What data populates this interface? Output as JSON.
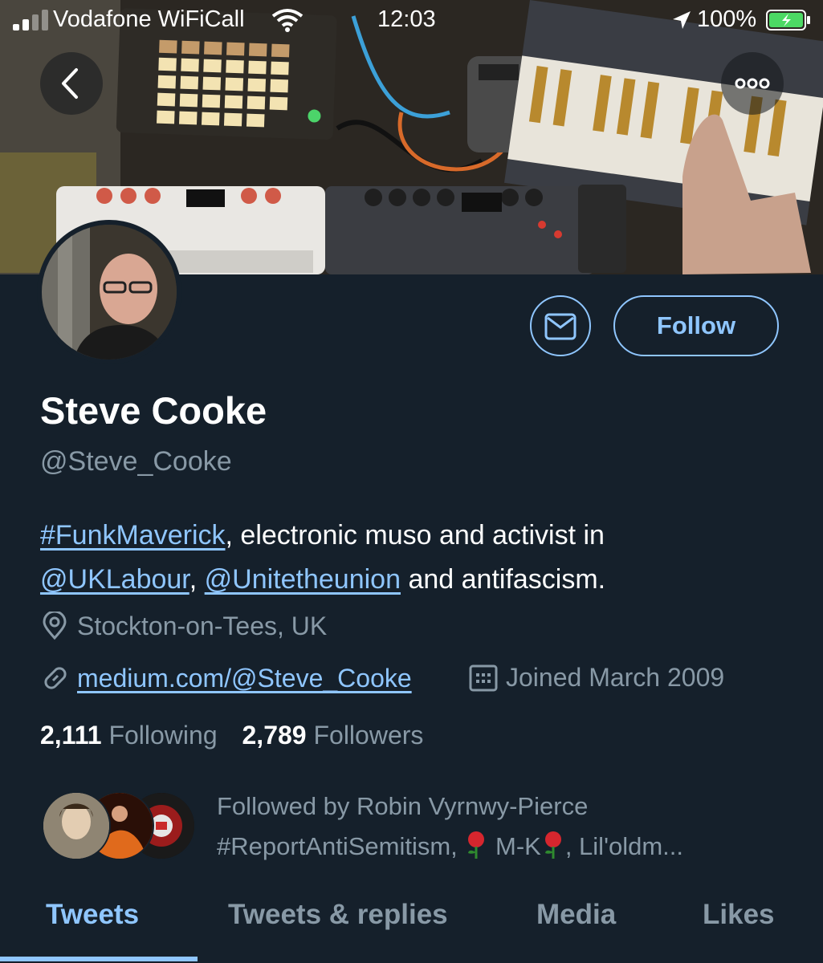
{
  "status_bar": {
    "carrier": "Vodafone WiFiCall",
    "time": "12:03",
    "battery": "100%"
  },
  "nav": {
    "back_icon": "chevron-left-icon",
    "more_icon": "more-horizontal-icon"
  },
  "profile": {
    "name": "Steve Cooke",
    "handle": "@Steve_Cooke",
    "bio": {
      "hashtag": "#FunkMaverick",
      "text1": ", electronic muso and activist in",
      "mention1": "@UKLabour",
      "sep": ", ",
      "mention2": "@Unitetheunion",
      "text2": " and antifascism."
    },
    "location": "Stockton-on-Tees, UK",
    "website": "medium.com/@Steve_Cooke",
    "joined": "Joined March 2009",
    "following_count": "2,111",
    "following_label": "Following",
    "followers_count": "2,789",
    "followers_label": "Followers",
    "followed_by_line1": "Followed by Robin Vyrnwy-Pierce",
    "followed_by_line2a": "#ReportAntiSemitism, ",
    "followed_by_line2b": " M-K",
    "followed_by_line2c": ", Lil'oldm..."
  },
  "actions": {
    "follow_label": "Follow",
    "message_icon": "mail-icon"
  },
  "tabs": [
    {
      "label": "Tweets",
      "active": true
    },
    {
      "label": "Tweets & replies",
      "active": false
    },
    {
      "label": "Media",
      "active": false
    },
    {
      "label": "Likes",
      "active": false
    }
  ],
  "colors": {
    "background": "#15202b",
    "accent": "#8fc6ff",
    "muted": "#8899a6",
    "text": "#ffffff"
  }
}
